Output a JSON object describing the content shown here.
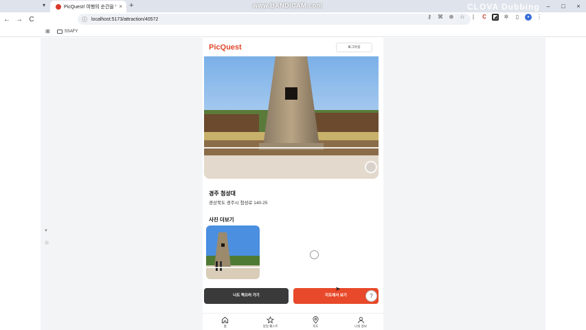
{
  "browser": {
    "tab_title": "PicQuest! 여행의 순간을 담다",
    "tab_close": "×",
    "new_tab": "+",
    "tab_menu": "▾",
    "watermark": "www.BANDICAM.com",
    "overlay_text": "CLOVA Dubbing",
    "url": "localhost:5173/attraction/40572",
    "bookmark_folder": "SSAFY",
    "window_controls": [
      "–",
      "□",
      "×"
    ],
    "nav": {
      "back": "←",
      "forward": "→",
      "reload": "C"
    }
  },
  "app": {
    "logo": "PicQuest",
    "logout_label": "로그아웃",
    "place": {
      "name": "경주 첨성대",
      "address": "경상북도 경주시 첨성로 140-25"
    },
    "more_photos_title": "사진 더보기",
    "buttons": {
      "take_photo": "나도 찍으러 가기",
      "view_on_map": "지도에서 보기",
      "help": "?"
    },
    "bottom_nav": [
      {
        "label": "홈",
        "icon": "home-icon"
      },
      {
        "label": "일일 퀘스트",
        "icon": "star-icon"
      },
      {
        "label": "지도",
        "icon": "map-pin-icon"
      },
      {
        "label": "나의 정보",
        "icon": "user-icon"
      }
    ]
  },
  "colors": {
    "brand": "#e0472a",
    "primary_button": "#e8492a",
    "secondary_button": "#3a3a3a"
  }
}
